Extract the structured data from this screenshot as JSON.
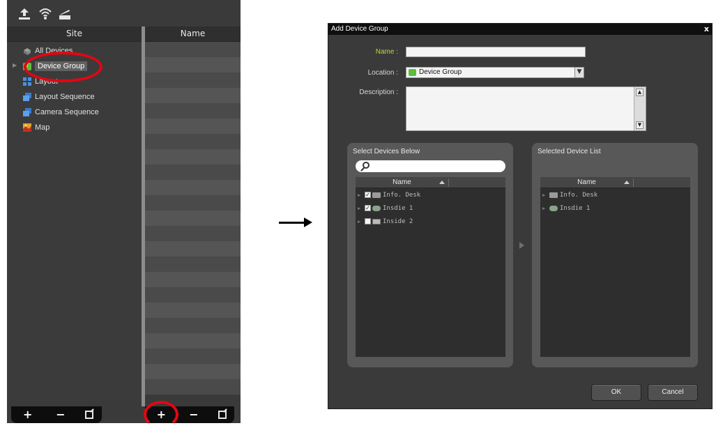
{
  "toolbar": {
    "icons": [
      "upload-icon",
      "wifi-icon",
      "eject-icon"
    ]
  },
  "left_panel": {
    "col_site": "Site",
    "col_name": "Name",
    "tree": [
      {
        "label": "All Devices",
        "icon": "devices-icon"
      },
      {
        "label": "Device Group",
        "icon": "device-group-icon",
        "selected": true
      },
      {
        "label": "Layout",
        "icon": "layout-icon"
      },
      {
        "label": "Layout Sequence",
        "icon": "layout-sequence-icon"
      },
      {
        "label": "Camera Sequence",
        "icon": "camera-sequence-icon"
      },
      {
        "label": "Map",
        "icon": "map-icon"
      }
    ],
    "bottom_buttons": [
      "+",
      "−"
    ]
  },
  "dialog": {
    "title": "Add Device Group",
    "close": "x",
    "name_label": "Name :",
    "name_value": "",
    "location_label": "Location :",
    "location_value": "Device Group",
    "description_label": "Description :",
    "description_value": "",
    "left_pane": {
      "title": "Select Devices Below",
      "search_placeholder": "",
      "header": "Name",
      "rows": [
        {
          "label": "Info. Desk",
          "checked": true
        },
        {
          "label": "Insdie 1",
          "checked": true
        },
        {
          "label": "Inside 2",
          "checked": false
        }
      ]
    },
    "right_pane": {
      "title": "Selected Device List",
      "header": "Name",
      "rows": [
        {
          "label": "Info. Desk"
        },
        {
          "label": "Insdie 1"
        }
      ]
    },
    "ok": "OK",
    "cancel": "Cancel"
  },
  "colors": {
    "accent": "#c5d534",
    "highlight_ellipse": "#e30613",
    "panel_bg": "#3a3a3a"
  }
}
